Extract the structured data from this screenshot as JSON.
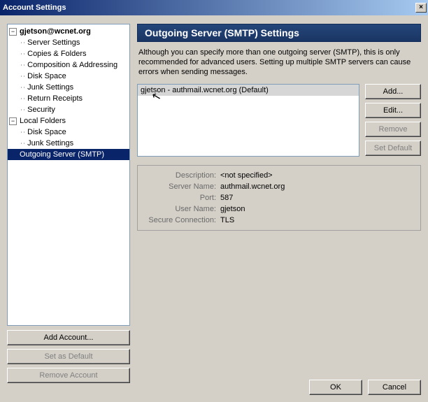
{
  "window": {
    "title": "Account Settings",
    "close": "×"
  },
  "tree": {
    "acct0": {
      "label": "gjetson@wcnet.org",
      "expand": "−"
    },
    "c0": "Server Settings",
    "c1": "Copies & Folders",
    "c2": "Composition & Addressing",
    "c3": "Disk Space",
    "c4": "Junk Settings",
    "c5": "Return Receipts",
    "c6": "Security",
    "local": {
      "label": "Local Folders",
      "expand": "−"
    },
    "l0": "Disk Space",
    "l1": "Junk Settings",
    "smtp": "Outgoing Server (SMTP)"
  },
  "sidebtns": {
    "add": "Add Account...",
    "setdef": "Set as Default",
    "remove": "Remove Account"
  },
  "header": "Outgoing Server (SMTP) Settings",
  "description": "Although you can specify more than one outgoing server (SMTP), this is only recommended for advanced users. Setting up multiple SMTP servers can cause errors when sending messages.",
  "smtp_list": {
    "item0": "gjetson - authmail.wcnet.org (Default)"
  },
  "smtp_btns": {
    "add": "Add...",
    "edit": "Edit...",
    "remove": "Remove",
    "setdef": "Set Default"
  },
  "details": {
    "labels": {
      "desc": "Description:",
      "server": "Server Name:",
      "port": "Port:",
      "user": "User Name:",
      "secure": "Secure Connection:"
    },
    "vals": {
      "desc": "<not specified>",
      "server": "authmail.wcnet.org",
      "port": "587",
      "user": "gjetson",
      "secure": "TLS"
    }
  },
  "bottom": {
    "ok": "OK",
    "cancel": "Cancel"
  }
}
